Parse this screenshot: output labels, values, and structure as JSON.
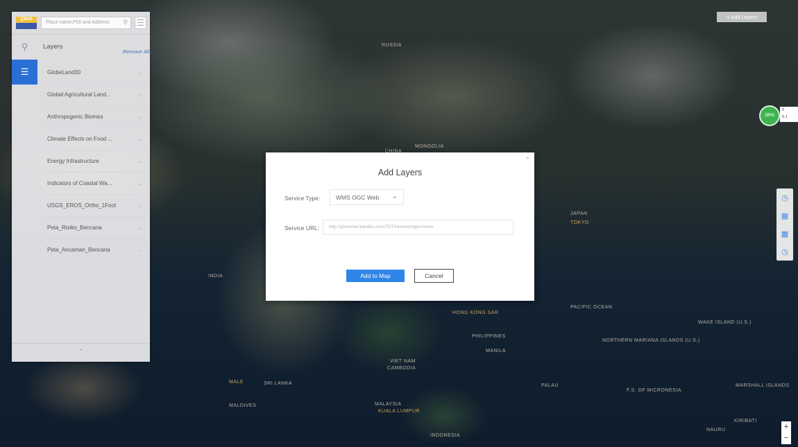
{
  "map": {
    "labels": [
      {
        "text": "RUSSIA",
        "hi": false
      },
      {
        "text": "CHINA",
        "hi": false
      },
      {
        "text": "JAPAN",
        "hi": false
      },
      {
        "text": "TOKYO",
        "hi": true
      },
      {
        "text": "MONGOLIA",
        "hi": false
      },
      {
        "text": "INDIA",
        "hi": false
      },
      {
        "text": "Hong Kong SAR",
        "hi": true
      },
      {
        "text": "PHILIPPINES",
        "hi": false
      },
      {
        "text": "MANILA",
        "hi": false
      },
      {
        "text": "VIET NAM",
        "hi": false
      },
      {
        "text": "CAMBODIA",
        "hi": false
      },
      {
        "text": "MALAYSIA",
        "hi": false
      },
      {
        "text": "KUALA LUMPUR",
        "hi": true
      },
      {
        "text": "INDONESIA",
        "hi": false
      },
      {
        "text": "SRI LANKA",
        "hi": false
      },
      {
        "text": "MALE",
        "hi": true
      },
      {
        "text": "MALDIVES",
        "hi": false
      },
      {
        "text": "PACIFIC OCEAN",
        "hi": false
      },
      {
        "text": "NORTHERN MARIANA ISLANDS (U.S.)",
        "hi": false
      },
      {
        "text": "PALAU",
        "hi": false
      },
      {
        "text": "F.S. OF MICRONESIA",
        "hi": false
      },
      {
        "text": "MARSHALL ISLANDS",
        "hi": false
      },
      {
        "text": "KIRIBATI",
        "hi": false
      },
      {
        "text": "NAURU",
        "hi": false
      },
      {
        "text": "WAKE ISLAND (U.S.)",
        "hi": false
      }
    ]
  },
  "sidebar": {
    "logo_text": "∑MAS",
    "search_placeholder": "Place name,POI and Address",
    "layers_title": "Layers",
    "remove_all": "Remove All",
    "layers": [
      {
        "label": "GlobeLand30"
      },
      {
        "label": "Global Agricultural Land..."
      },
      {
        "label": "Anthropogenic Biomes"
      },
      {
        "label": "Climate Effects on Food ..."
      },
      {
        "label": "Energy Infrastructure"
      },
      {
        "label": "Indicators of Coastal Wa..."
      },
      {
        "label": "USGS_EROS_Ortho_1Foot"
      },
      {
        "label": "Peta_Risiko_Bencana"
      },
      {
        "label": "Peta_Ancaman_Bencana"
      }
    ],
    "collapse_glyph": "⌃"
  },
  "dialog": {
    "title": "Add Layers",
    "close_glyph": "×",
    "service_type_label": "Service Type:",
    "service_type_value": "WMS OGC Web",
    "service_url_label": "Service URL:",
    "service_url_placeholder": "http://gisserver.tianditu.com/TDTService/region/wms",
    "add_button": "Add to Map",
    "cancel_button": "Cancel"
  },
  "toolbar": {
    "add_layers_button": "+ Add Layers"
  },
  "network_widget": {
    "percent": "38%",
    "up": "0",
    "down": "0.1"
  },
  "zoom": {
    "in": "+",
    "out": "−"
  },
  "colors": {
    "accent": "#2f86e8",
    "active_tool": "#2a6fd6",
    "status_green": "#3fb34f"
  }
}
